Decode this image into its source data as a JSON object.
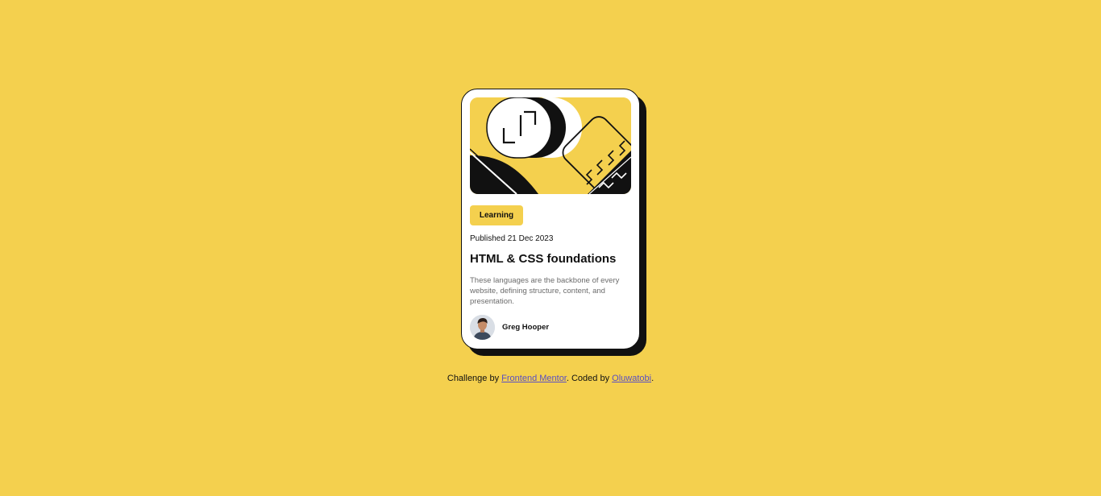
{
  "colors": {
    "background": "#F4D04E",
    "card": "#FFFFFF",
    "ink": "#111111",
    "muted_text": "#6B6B6B",
    "link": "#5A4FC2"
  },
  "card": {
    "illustration_icon": "abstract-geometric-illustration",
    "tag": "Learning",
    "published": "Published 21 Dec 2023",
    "title": "HTML & CSS foundations",
    "description": "These languages are the backbone of every website, defining structure, content, and presentation.",
    "author": {
      "avatar_icon": "author-portrait",
      "name": "Greg Hooper"
    }
  },
  "attribution": {
    "prefix": "Challenge by ",
    "link1": "Frontend Mentor",
    "middle": ". Coded by ",
    "link2": "Oluwatobi",
    "suffix": "."
  }
}
